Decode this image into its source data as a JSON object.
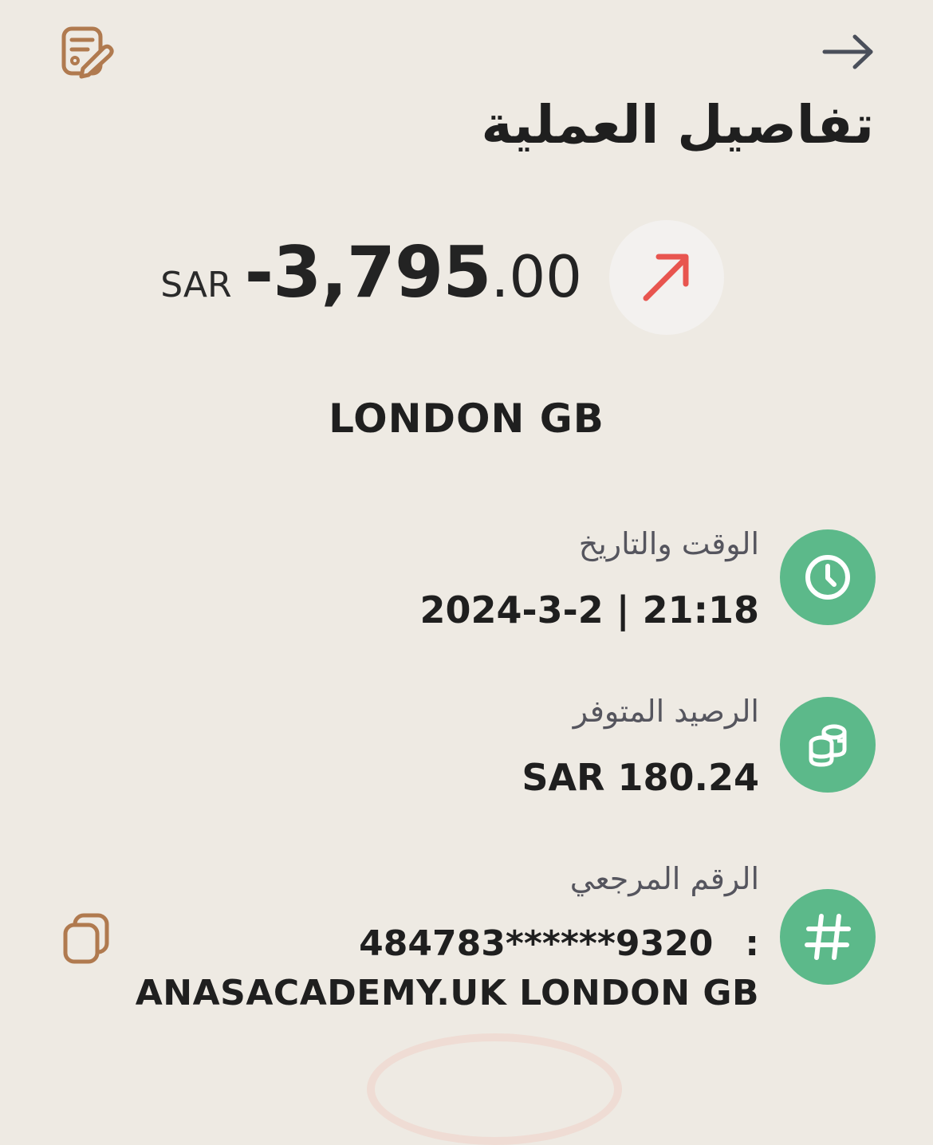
{
  "header": {
    "title": "تفاصيل العملية",
    "edit_icon": "edit-note-icon",
    "back_icon": "arrow-right-icon"
  },
  "transaction": {
    "currency": "SAR",
    "amount_main": "-3,795",
    "amount_decimal": ".00",
    "direction_icon": "arrow-up-right-icon",
    "direction_color": "#e8554f",
    "merchant": "LONDON GB"
  },
  "details": {
    "datetime": {
      "label": "الوقت والتاريخ",
      "value": "2024-3-2 | 21:18",
      "icon": "clock-icon"
    },
    "balance": {
      "label": "الرصيد المتوفر",
      "value": "SAR 180.24",
      "icon": "coins-icon"
    },
    "reference": {
      "label": "الرقم المرجعي",
      "card_number": "484783******9320",
      "separator": ":",
      "description": "ANASACADEMY.UK LONDON GB",
      "icon": "hash-icon",
      "copy_icon": "copy-icon"
    }
  },
  "colors": {
    "background": "#eeeae3",
    "accent_green": "#5cb98a",
    "accent_brown": "#b07a4f",
    "debit_red": "#e8554f"
  }
}
